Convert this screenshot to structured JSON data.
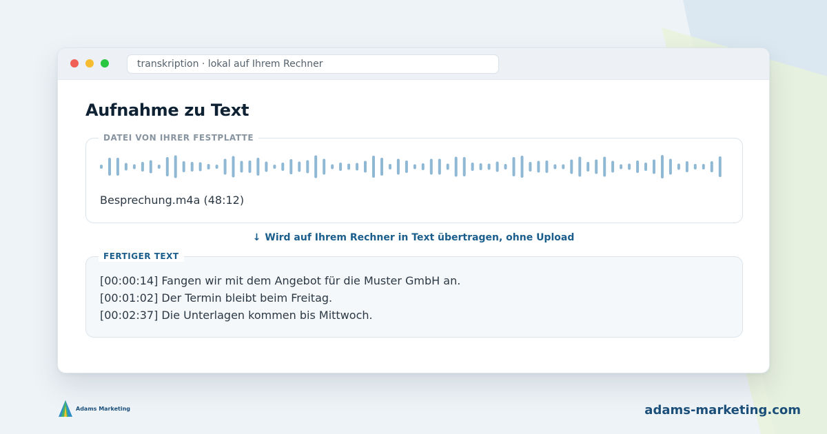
{
  "window": {
    "address": "transkription · lokal auf Ihrem Rechner"
  },
  "page": {
    "heading": "Aufnahme zu Text"
  },
  "file_panel": {
    "legend": "DATEI VON IHRER FESTPLATTE",
    "filename": "Besprechung.m4a (48:12)",
    "waveform_color": "#8fb8d4"
  },
  "flow": {
    "arrow": "↓",
    "text": "Wird auf Ihrem Rechner in Text übertragen, ohne Upload"
  },
  "result_panel": {
    "legend": "FERTIGER TEXT",
    "lines": [
      "[00:00:14] Fangen wir mit dem Angebot für die Muster GmbH an.",
      "[00:01:02] Der Termin bleibt beim Freitag.",
      "[00:02:37] Die Unterlagen kommen bis Mittwoch."
    ]
  },
  "footer": {
    "brand_name": "Adams Marketing",
    "site": "adams-marketing.com"
  },
  "colors": {
    "accent": "#1b5e8c",
    "heading": "#0f2233"
  }
}
